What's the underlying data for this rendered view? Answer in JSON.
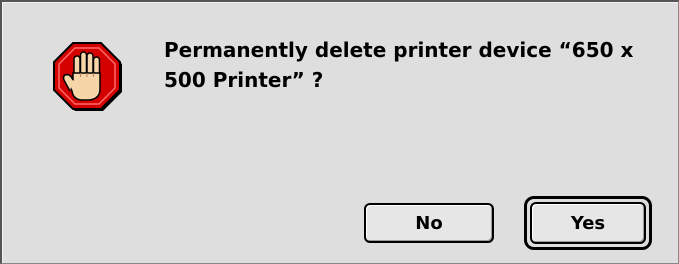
{
  "dialog": {
    "icon": "stop-hand-icon",
    "message": "Permanently delete printer device “650 x 500 Printer” ?",
    "buttons": {
      "no_label": "No",
      "yes_label": "Yes",
      "default": "Yes"
    }
  },
  "colors": {
    "dialog_background": "#dedede",
    "stop_sign_red": "#d40000",
    "hand_skin": "#f6d6a8"
  }
}
